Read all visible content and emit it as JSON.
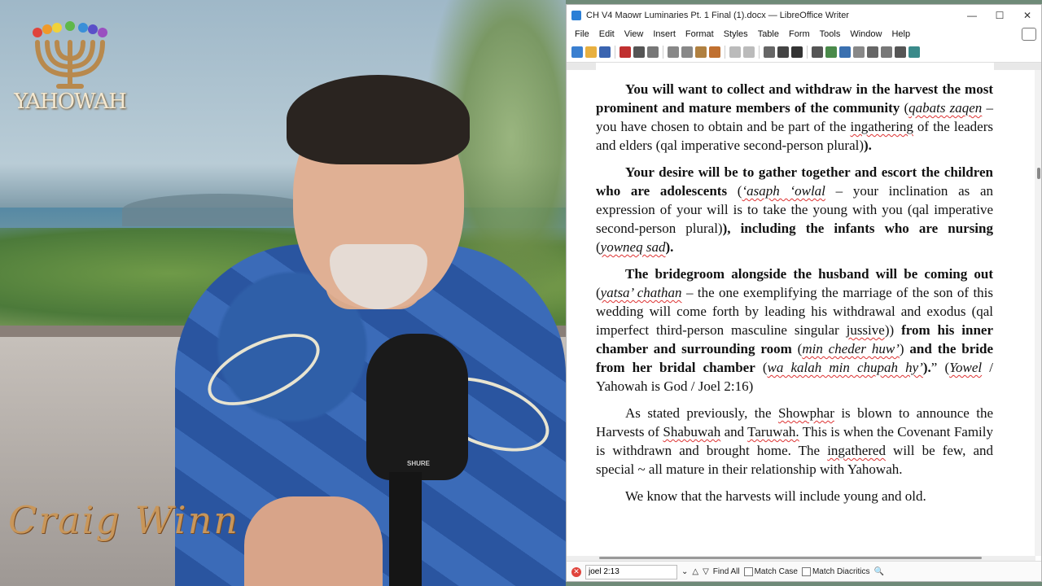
{
  "overlay": {
    "logo_text": "YAHOWAH",
    "signature": "Craig Winn"
  },
  "window": {
    "title": "CH V4 Maowr Luminaries Pt. 1 Final (1).docx — LibreOffice Writer",
    "minimize": "—",
    "maximize": "☐",
    "close": "✕"
  },
  "menu": {
    "items": [
      "File",
      "Edit",
      "View",
      "Insert",
      "Format",
      "Styles",
      "Table",
      "Form",
      "Tools",
      "Window",
      "Help"
    ]
  },
  "document": {
    "p1": {
      "a": "You will want to collect and withdraw in the harvest the most prominent and mature members of the community",
      "b": " (",
      "c": "qabats zaqen",
      "d": " – you have chosen to obtain and be part of the ",
      "e": "ingathering",
      "f": " of the leaders and elders (qal imperative second-person plural)",
      "g": ")."
    },
    "p2": {
      "a": "Your desire will be to gather together and escort the children who are adolescents",
      "b": " (",
      "c": "‘asaph ‘owlal",
      "d": " – your inclination as an expression of your will is to take the young with you (qal imperative second-person plural)",
      "e": "), including the infants who are nursing",
      "f": " (",
      "g": "yowneq sad",
      "h": ")."
    },
    "p3": {
      "a": "The bridegroom alongside the husband will be coming out",
      "b": " (",
      "c": "yatsa’ chathan",
      "d": " – the one exemplifying the marriage of the son of this wedding will come forth by leading his withdrawal and exodus (qal imperfect third-person masculine singular ",
      "e": "jussive",
      "f": ")) ",
      "g": "from his inner chamber and surrounding room",
      "h": " (",
      "i": "min cheder huw’",
      "j": ") ",
      "k": "and the bride from her bridal chamber",
      "l": " (",
      "m": "wa kalah min chupah hy’",
      "n": ").",
      "o": "” (",
      "p": "Yowel",
      "q": " / Yahowah is God / Joel 2:16)"
    },
    "p4": {
      "a": "As stated previously, the ",
      "b": "Showphar",
      "c": " is blown to announce the Harvests of ",
      "d": "Shabuwah",
      "e": " and ",
      "f": "Taruwah.",
      "g": " This is when the Covenant Family is withdrawn and brought home. The ",
      "h": "ingathered",
      "i": " will be few, and special ~ all mature in their relationship with Yahowah."
    },
    "p5": {
      "a": "We know that the harvests will include young and old."
    }
  },
  "findbar": {
    "query": "joel 2:13",
    "find_all": "Find All",
    "match_case": "Match Case",
    "match_diacritics": "Match Diacritics"
  }
}
